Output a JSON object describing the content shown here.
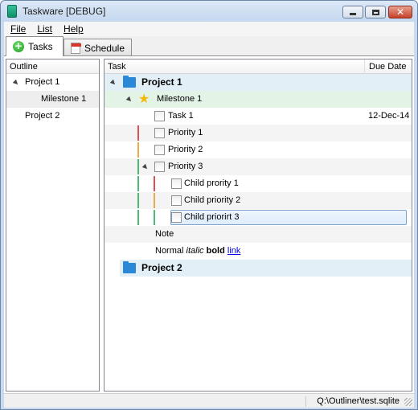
{
  "window": {
    "title": "Taskware [DEBUG]"
  },
  "menu": {
    "file": "File",
    "list": "List",
    "help": "Help"
  },
  "tabs": [
    {
      "label": "Tasks",
      "icon": "plus-circle-icon"
    },
    {
      "label": "Schedule",
      "icon": "calendar-icon"
    }
  ],
  "outline": {
    "header": "Outline",
    "items": [
      {
        "label": "Project 1"
      },
      {
        "label": "Milestone 1"
      },
      {
        "label": "Project 2"
      }
    ]
  },
  "tasks": {
    "header_task": "Task",
    "header_due": "Due Date",
    "rows": {
      "project1": "Project 1",
      "milestone1": "Milestone 1",
      "task1": "Task 1",
      "task1_due": "12-Dec-14",
      "priority1": "Priority 1",
      "priority2": "Priority 2",
      "priority3": "Priority 3",
      "child1": "Child prority 1",
      "child2": "Child priority 2",
      "child3": "Child priorirt 3",
      "note": "Note",
      "normal": "Normal",
      "italic": "italic",
      "bold": "bold",
      "link": "link",
      "project2": "Project 2"
    },
    "colors": {
      "priority1": "#e05050",
      "priority2": "#f0a848",
      "priority3": "#4cba74"
    }
  },
  "status": {
    "path": "Q:\\Outliner\\test.sqlite"
  }
}
